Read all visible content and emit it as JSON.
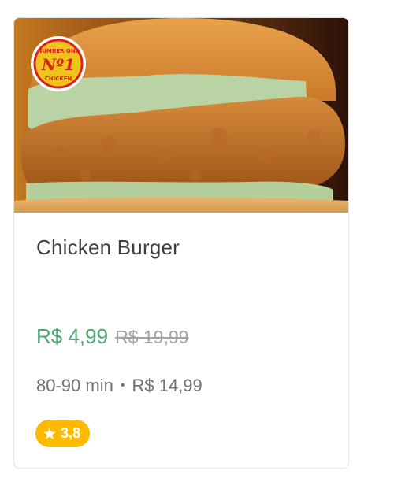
{
  "card": {
    "image_alt": "Chicken burger photo",
    "logo_lines": [
      "NUMBER ONE",
      "Nº1",
      "CHICKEN"
    ],
    "title": "Chicken Burger",
    "price": "R$ 4,99",
    "old_price": "R$ 19,99",
    "delivery_time": "80-90 min",
    "separator": "•",
    "delivery_fee": "R$ 14,99",
    "rating": "3,8",
    "rating_icon": "star-icon"
  },
  "colors": {
    "price": "#50a773",
    "rating_badge": "#fcbb00",
    "title": "#3f3e3e"
  }
}
